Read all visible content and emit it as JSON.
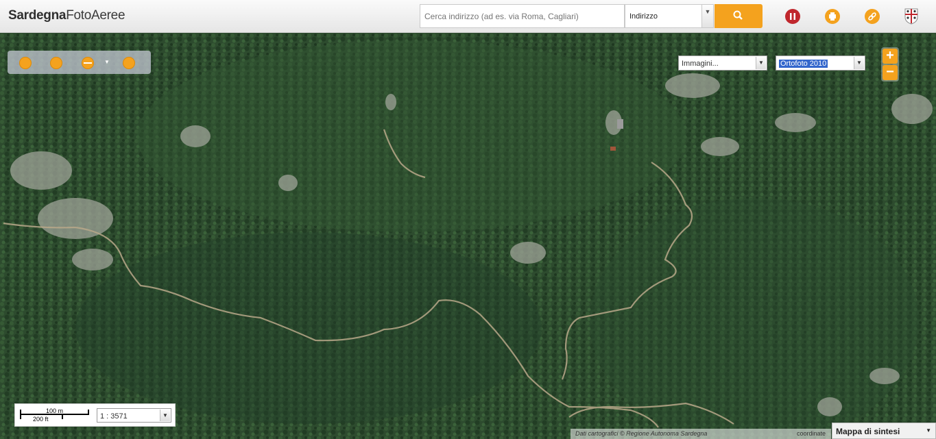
{
  "app": {
    "logo_bold": "Sardegna",
    "logo_light": "FotoAeree"
  },
  "search": {
    "placeholder": "Cerca indirizzo (ad es. via Roma, Cagliari)",
    "type_value": "Indirizzo"
  },
  "header_icons": [
    "search-icon",
    "no-entry-icon",
    "printer-icon",
    "link-icon",
    "region-logo-icon"
  ],
  "map": {
    "tools": [
      "zoom-extent-icon",
      "draw-area-icon",
      "measure-icon",
      "dropdown-arrow-icon",
      "compass-icon"
    ],
    "images_select": "Immagini...",
    "layer_select": "Ortofoto 2010",
    "zoom_in": "+",
    "zoom_out": "−",
    "scale": {
      "metric": "100 m",
      "imperial": "200 ft",
      "ratio": "1 : 3571"
    },
    "attribution": "Dati cartografici © Regione Autonoma Sardegna",
    "coordinates_label": "coordinate",
    "overview_label": "Mappa di sintesi"
  },
  "colors": {
    "accent": "#f4a21e",
    "forest": "#2c4a2c",
    "path": "#b9a88a"
  }
}
